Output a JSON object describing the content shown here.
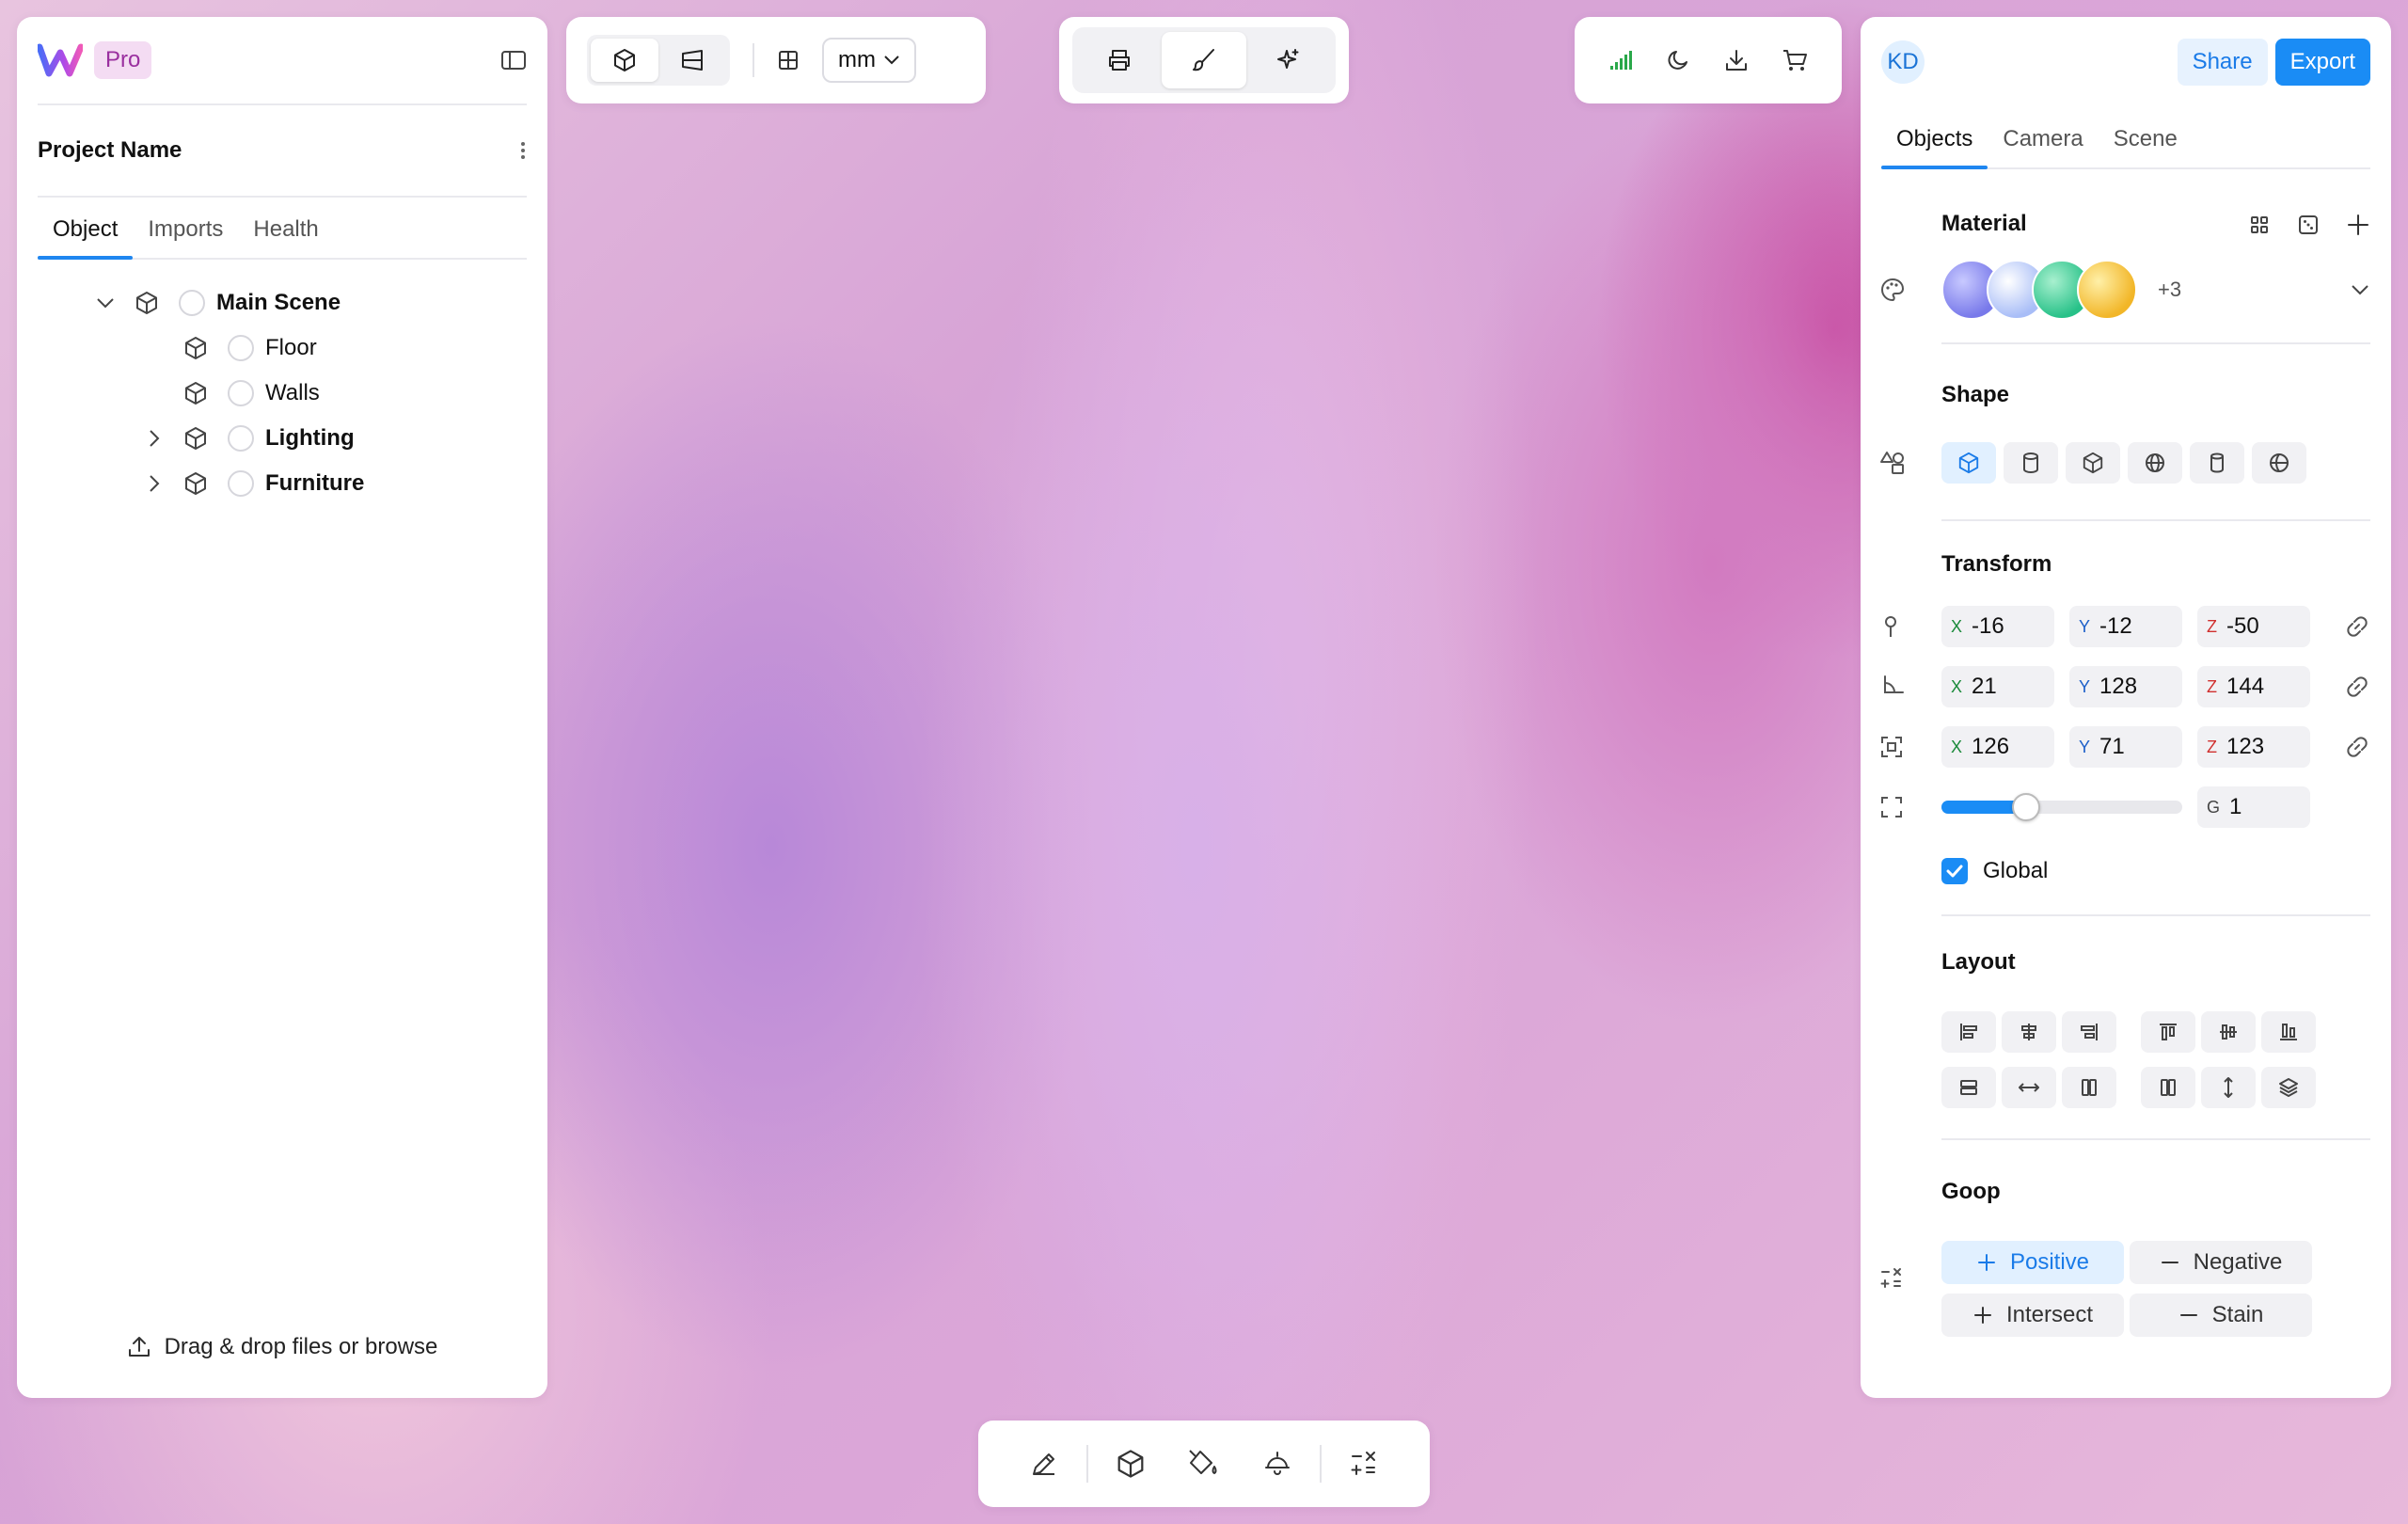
{
  "app": {
    "plan_badge": "Pro",
    "project_name": "Project Name"
  },
  "left_tabs": [
    {
      "label": "Object"
    },
    {
      "label": "Imports"
    },
    {
      "label": "Health"
    }
  ],
  "tree": {
    "items": [
      {
        "label": "Main Scene",
        "bold": true
      },
      {
        "label": "Floor"
      },
      {
        "label": "Walls"
      },
      {
        "label": "Lighting",
        "bold": true
      },
      {
        "label": "Furniture",
        "bold": true
      }
    ]
  },
  "drop": {
    "text": "Drag & drop files or ",
    "link": "browse"
  },
  "units": {
    "selected": "mm"
  },
  "user": {
    "initials": "KD"
  },
  "actions": {
    "share": "Share",
    "export": "Export"
  },
  "right_tabs": [
    {
      "label": "Objects"
    },
    {
      "label": "Camera"
    },
    {
      "label": "Scene"
    }
  ],
  "material": {
    "title": "Material",
    "more": "+3",
    "swatches": [
      "#8d8ef0",
      "#b4c6f6",
      "#3fd09a",
      "#f4c542"
    ]
  },
  "shape": {
    "title": "Shape"
  },
  "transform": {
    "title": "Transform",
    "position": {
      "x": "-16",
      "y": "-12",
      "z": "-50"
    },
    "rotation": {
      "x": "21",
      "y": "128",
      "z": "144"
    },
    "scale": {
      "x": "126",
      "y": "71",
      "z": "123"
    },
    "global_scale": {
      "label": "G",
      "value": "1",
      "slider_fraction": 0.35
    },
    "axis_labels": {
      "x": "X",
      "y": "Y",
      "z": "Z"
    },
    "global_checkbox": "Global"
  },
  "layout": {
    "title": "Layout"
  },
  "goop": {
    "title": "Goop",
    "positive": "Positive",
    "negative": "Negative",
    "intersect": "Intersect",
    "stain": "Stain"
  },
  "colors": {
    "accent": "#1a8cf5"
  }
}
